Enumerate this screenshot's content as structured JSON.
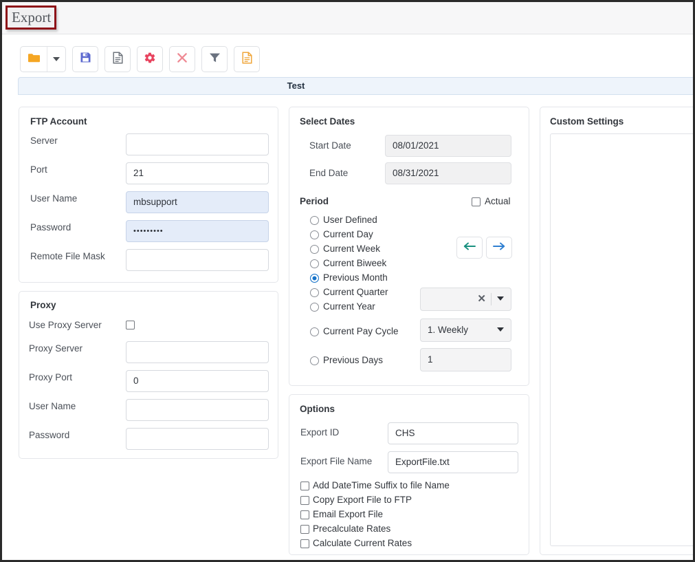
{
  "window": {
    "title": "Export"
  },
  "toolbar": {
    "buttons": [
      {
        "name": "open-folder",
        "icon": "folder-icon",
        "color": "#f5a623"
      },
      {
        "name": "open-folder-dropdown",
        "icon": "chevron-down-icon",
        "color": "#4d5156"
      },
      {
        "name": "save",
        "icon": "save-floppy-icon",
        "color": "#5b68cf"
      },
      {
        "name": "new-document",
        "icon": "document-icon",
        "color": "#6f757d"
      },
      {
        "name": "settings",
        "icon": "gear-icon",
        "color": "#e8445f"
      },
      {
        "name": "delete",
        "icon": "close-x-icon",
        "color": "#ef8a94"
      },
      {
        "name": "filter",
        "icon": "funnel-icon",
        "color": "#6b7280"
      },
      {
        "name": "report",
        "icon": "document-yellow-icon",
        "color": "#f0a63a"
      }
    ]
  },
  "band": {
    "label": "Test"
  },
  "ftp": {
    "title": "FTP Account",
    "fields": [
      {
        "label": "Server",
        "value": "",
        "state": "empty"
      },
      {
        "label": "Port",
        "value": "21",
        "state": "empty"
      },
      {
        "label": "User Name",
        "value": "mbsupport",
        "state": "filled"
      },
      {
        "label": "Password",
        "value": "•••••••••",
        "state": "filled"
      },
      {
        "label": "Remote File Mask",
        "value": "",
        "state": "empty"
      }
    ]
  },
  "proxy": {
    "title": "Proxy",
    "use_proxy_label": "Use Proxy Server",
    "use_proxy_checked": false,
    "fields": [
      {
        "label": "Proxy Server",
        "value": ""
      },
      {
        "label": "Proxy Port",
        "value": "0"
      },
      {
        "label": "User Name",
        "value": ""
      },
      {
        "label": "Password",
        "value": ""
      }
    ]
  },
  "dates": {
    "title": "Select Dates",
    "start_label": "Start Date",
    "start_value": "08/01/2021",
    "end_label": "End Date",
    "end_value": "08/31/2021",
    "period_label": "Period",
    "actual_label": "Actual",
    "actual_checked": false,
    "radios": [
      {
        "label": "User Defined",
        "selected": false
      },
      {
        "label": "Current Day",
        "selected": false
      },
      {
        "label": "Current Week",
        "selected": false
      },
      {
        "label": "Current Biweek",
        "selected": false
      },
      {
        "label": "Previous Month",
        "selected": true
      },
      {
        "label": "Current Quarter",
        "selected": false
      },
      {
        "label": "Current Year",
        "selected": false
      }
    ],
    "pay_cycle_label": "Current Pay Cycle",
    "pay_cycle_selected": false,
    "pay_cycle_value": "1. Weekly",
    "previous_days_label": "Previous Days",
    "previous_days_selected": false,
    "previous_days_value": "1",
    "quarter_select_value": "",
    "nav_prev_icon": "arrow-left-icon",
    "nav_next_icon": "arrow-right-icon",
    "nav_prev_color": "#18907f",
    "nav_next_color": "#2f7fd1"
  },
  "options": {
    "title": "Options",
    "export_id_label": "Export ID",
    "export_id_value": "CHS",
    "export_file_label": "Export File Name",
    "export_file_value": "ExportFile.txt",
    "checkboxes": [
      {
        "label": "Add DateTime Suffix to file Name",
        "checked": false
      },
      {
        "label": "Copy Export File to FTP",
        "checked": false
      },
      {
        "label": "Email Export File",
        "checked": false
      },
      {
        "label": "Precalculate Rates",
        "checked": false
      },
      {
        "label": "Calculate Current Rates",
        "checked": false
      }
    ]
  },
  "custom": {
    "title": "Custom Settings"
  },
  "theme": {
    "accent_blue": "#1673c9",
    "band_blue": "#eef4fb",
    "highlight_red": "#8d1118",
    "field_filled": "#e4ecf9"
  }
}
